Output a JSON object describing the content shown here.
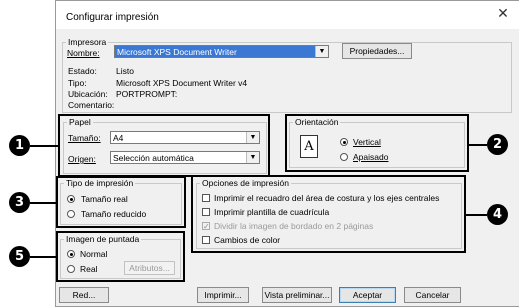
{
  "title": "Configurar impresión",
  "close_glyph": "✕",
  "printer": {
    "group_label": "Impresora",
    "name_label": "Nombre:",
    "name_value": "Microsoft XPS Document Writer",
    "properties_button": "Propiedades...",
    "status_label": "Estado:",
    "status_value": "Listo",
    "type_label": "Tipo:",
    "type_value": "Microsoft XPS Document Writer v4",
    "location_label": "Ubicación:",
    "location_value": "PORTPROMPT:",
    "comment_label": "Comentario:"
  },
  "paper": {
    "group_label": "Papel",
    "size_label": "Tamaño:",
    "size_value": "A4",
    "source_label": "Origen:",
    "source_value": "Selección automática"
  },
  "orientation": {
    "group_label": "Orientación",
    "icon_letter": "A",
    "vertical": "Vertical",
    "landscape": "Apaisado",
    "selected": "vertical"
  },
  "print_type": {
    "group_label": "Tipo de impresión",
    "actual_size": "Tamaño real",
    "reduced_size": "Tamaño reducido",
    "selected": "actual_size"
  },
  "print_options": {
    "group_label": "Opciones de impresión",
    "options": [
      {
        "label": "Imprimir el recuadro del área de costura y los ejes centrales",
        "checked": false,
        "enabled": true
      },
      {
        "label": "Imprimir plantilla de cuadrícula",
        "checked": false,
        "enabled": true
      },
      {
        "label": "Dividir la imagen de bordado en 2 páginas",
        "checked": true,
        "enabled": false
      },
      {
        "label": "Cambios de color",
        "checked": false,
        "enabled": true
      }
    ]
  },
  "stitch_image": {
    "group_label": "Imagen de puntada",
    "normal": "Normal",
    "real": "Real",
    "attributes_button": "Atributos...",
    "selected": "normal"
  },
  "buttons": {
    "network": "Red...",
    "print": "Imprimir...",
    "preview": "Vista preliminar...",
    "accept": "Aceptar",
    "cancel": "Cancelar"
  },
  "callouts": [
    "1",
    "2",
    "3",
    "4",
    "5"
  ]
}
